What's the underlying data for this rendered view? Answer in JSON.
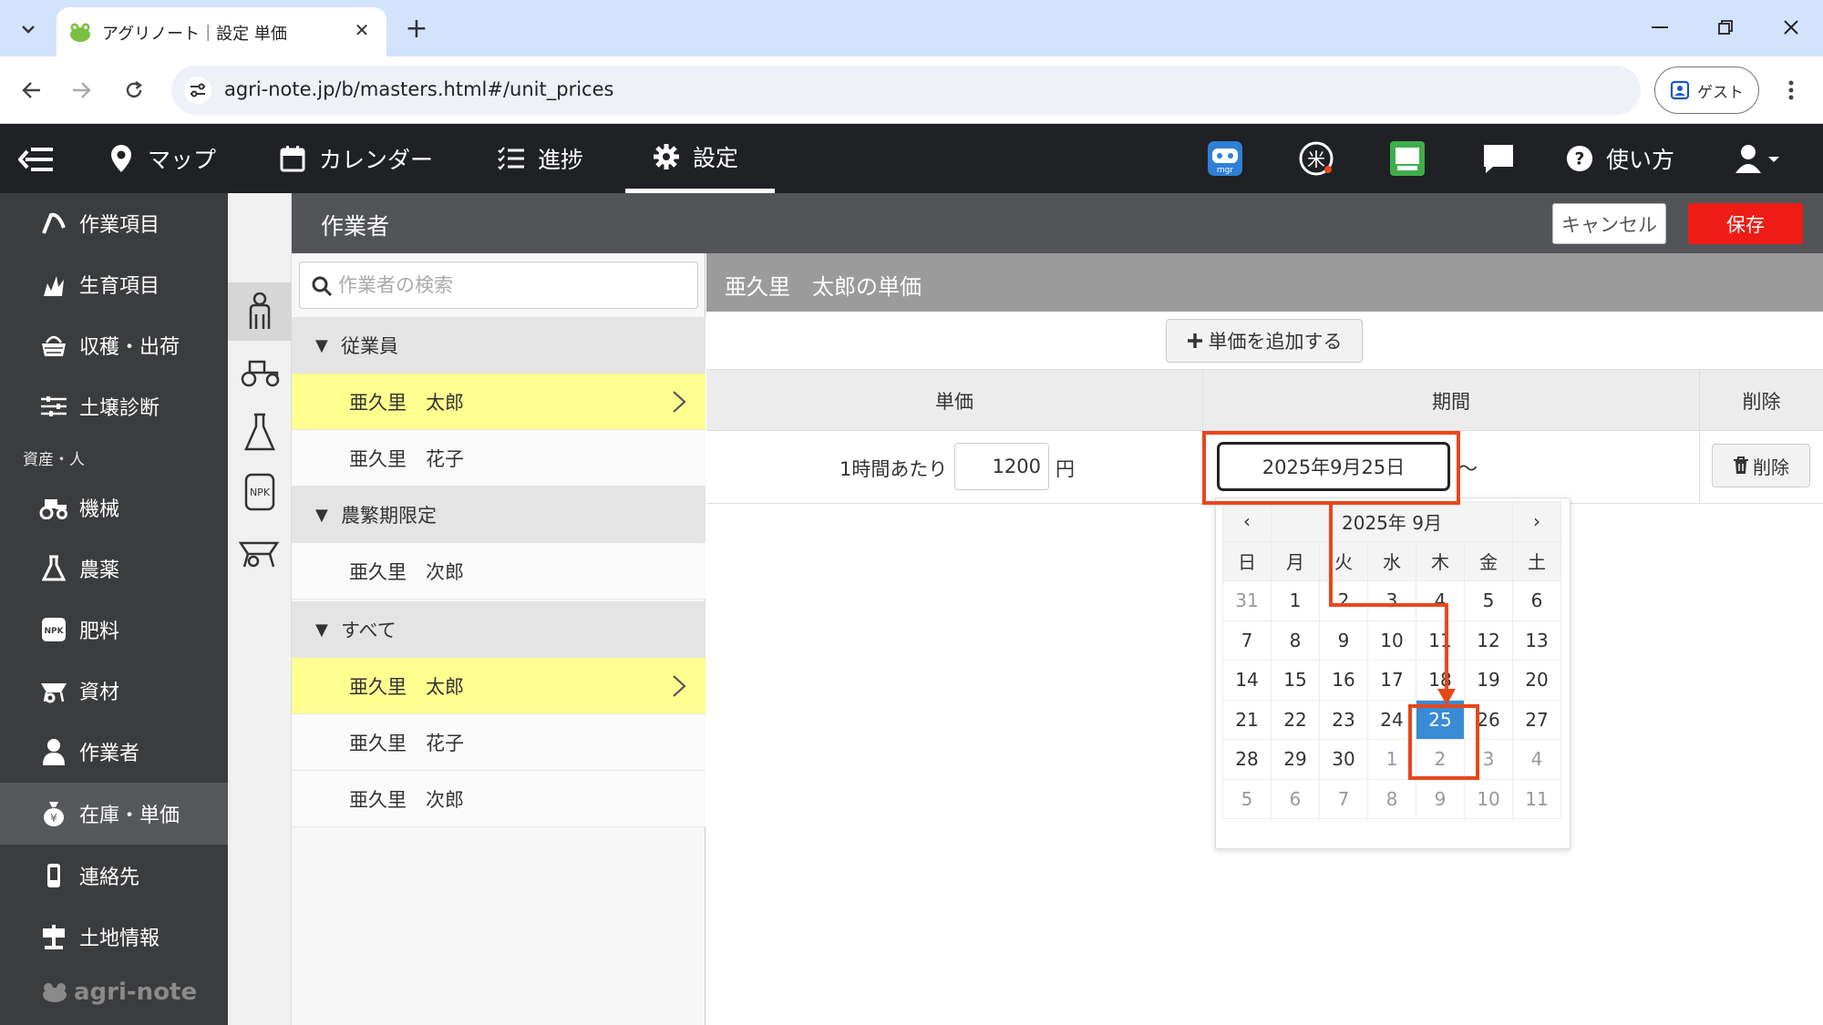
{
  "browser": {
    "tab_title": "アグリノート｜設定 単価",
    "tab_close": "✕",
    "new_tab": "+",
    "url": "agri-note.jp/b/masters.html#/unit_prices",
    "profile_label": "ゲスト"
  },
  "topnav": {
    "items": [
      {
        "label": "マップ",
        "icon": "map-pin-icon"
      },
      {
        "label": "カレンダー",
        "icon": "calendar-icon"
      },
      {
        "label": "進捗",
        "icon": "checklist-icon"
      },
      {
        "label": "設定",
        "icon": "gear-icon"
      }
    ],
    "active": "設定",
    "help_label": "使い方",
    "app_icons": [
      "mgr-app-icon",
      "rice-app-icon",
      "market-app-icon",
      "chat-icon"
    ]
  },
  "sidebar": {
    "items_top": [
      "作業項目",
      "生育項目",
      "収穫・出荷",
      "土壌診断"
    ],
    "section_label": "資産・人",
    "items_bottom": [
      "機械",
      "農薬",
      "肥料",
      "資材",
      "作業者",
      "在庫・単価",
      "連絡先",
      "土地情報"
    ],
    "active": "在庫・単価",
    "logo_text": "agri-note"
  },
  "header": {
    "title": "作業者",
    "cancel_label": "キャンセル",
    "save_label": "保存"
  },
  "list": {
    "search_placeholder": "作業者の検索",
    "groups": [
      {
        "label": "従業員",
        "members": [
          "亜久里　太郎",
          "亜久里　花子"
        ]
      },
      {
        "label": "農繁期限定",
        "members": [
          "亜久里　次郎"
        ]
      },
      {
        "label": "すべて",
        "members": [
          "亜久里　太郎",
          "亜久里　花子",
          "亜久里　次郎"
        ]
      }
    ],
    "selected": "亜久里　太郎"
  },
  "detail": {
    "title": "亜久里　太郎の単価",
    "add_label": "単価を追加する",
    "col_price": "単価",
    "col_period": "期間",
    "col_delete": "削除",
    "row": {
      "unit_label": "1時間あたり",
      "price": "1200",
      "currency": "円",
      "date": "2025年9月25日",
      "tilde": "～",
      "delete_label": "削除"
    }
  },
  "calendar": {
    "title": "2025年 9月",
    "prev": "‹",
    "next": "›",
    "weekdays": [
      "日",
      "月",
      "火",
      "水",
      "木",
      "金",
      "土"
    ],
    "weeks": [
      [
        "31",
        "1",
        "2",
        "3",
        "4",
        "5",
        "6"
      ],
      [
        "7",
        "8",
        "9",
        "10",
        "11",
        "12",
        "13"
      ],
      [
        "14",
        "15",
        "16",
        "17",
        "18",
        "19",
        "20"
      ],
      [
        "21",
        "22",
        "23",
        "24",
        "25",
        "26",
        "27"
      ],
      [
        "28",
        "29",
        "30",
        "1",
        "2",
        "3",
        "4"
      ],
      [
        "5",
        "6",
        "7",
        "8",
        "9",
        "10",
        "11"
      ]
    ],
    "selected_day": "25",
    "selected_color": "#3a8bd6"
  },
  "annotation_color": "#e8471b"
}
